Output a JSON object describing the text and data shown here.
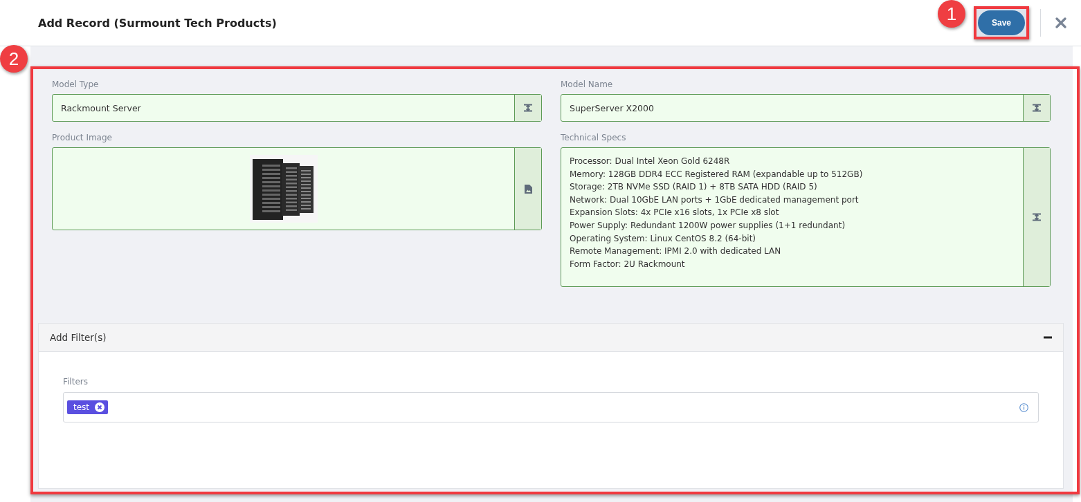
{
  "header": {
    "title": "Add Record (Surmount Tech Products)",
    "save_button": "Save"
  },
  "callouts": {
    "save": "1",
    "form": "2"
  },
  "fields": [
    {
      "label": "Model Type",
      "kind": "text",
      "value": "Rackmount Server"
    },
    {
      "label": "Model Name",
      "kind": "text",
      "value": "SuperServer X2000"
    },
    {
      "label": "Product Image",
      "kind": "image"
    },
    {
      "label": "Technical Specs",
      "kind": "textarea",
      "value": "Processor: Dual Intel Xeon Gold 6248R\nMemory: 128GB DDR4 ECC Registered RAM (expandable up to 512GB)\nStorage: 2TB NVMe SSD (RAID 1) + 8TB SATA HDD (RAID 5)\nNetwork: Dual 10GbE LAN ports + 1GbE dedicated management port\nExpansion Slots: 4x PCIe x16 slots, 1x PCIe x8 slot\nPower Supply: Redundant 1200W power supplies (1+1 redundant)\nOperating System: Linux CentOS 8.2 (64-bit)\nRemote Management: IPMI 2.0 with dedicated LAN\nForm Factor: 2U Rackmount"
    }
  ],
  "filter_panel": {
    "title": "Add Filter(s)",
    "expanded": true,
    "label": "Filters",
    "tags": [
      "test"
    ]
  }
}
